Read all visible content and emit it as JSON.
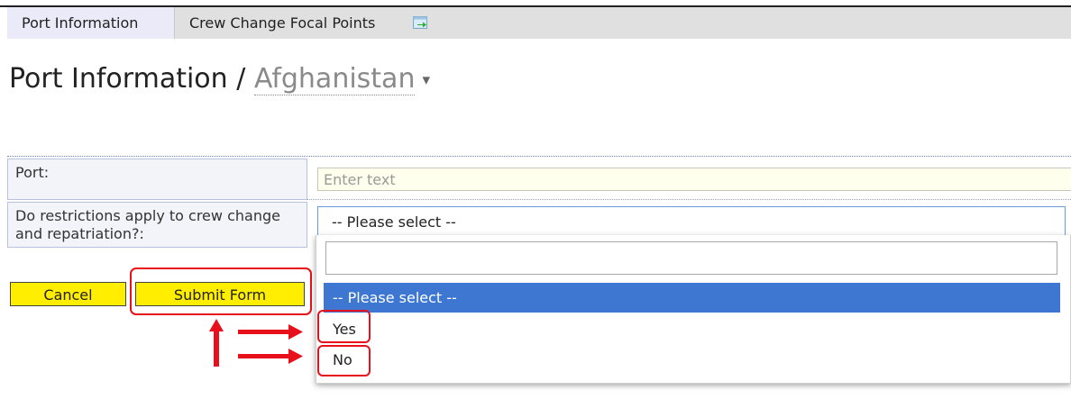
{
  "tabs": {
    "port_information": "Port Information",
    "crew_change": "Crew Change Focal Points"
  },
  "page": {
    "title_prefix": "Port Information /",
    "country": "Afghanistan",
    "caret": "▾"
  },
  "form": {
    "port_label": "Port:",
    "port_placeholder": "Enter text",
    "restrictions_label": "Do restrictions apply to crew change and repatriation?:",
    "restrictions_selected": "-- Please select --"
  },
  "dropdown": {
    "search_value": "",
    "options": [
      "-- Please select --",
      "Yes",
      "No"
    ]
  },
  "buttons": {
    "cancel": "Cancel",
    "submit": "Submit Form"
  },
  "colors": {
    "button_bg": "#ffee00",
    "highlight": "#e8101a",
    "selected_option": "#3e77d1"
  },
  "icons": {
    "external": "external-link-icon",
    "arrows": "annotation-arrows"
  }
}
